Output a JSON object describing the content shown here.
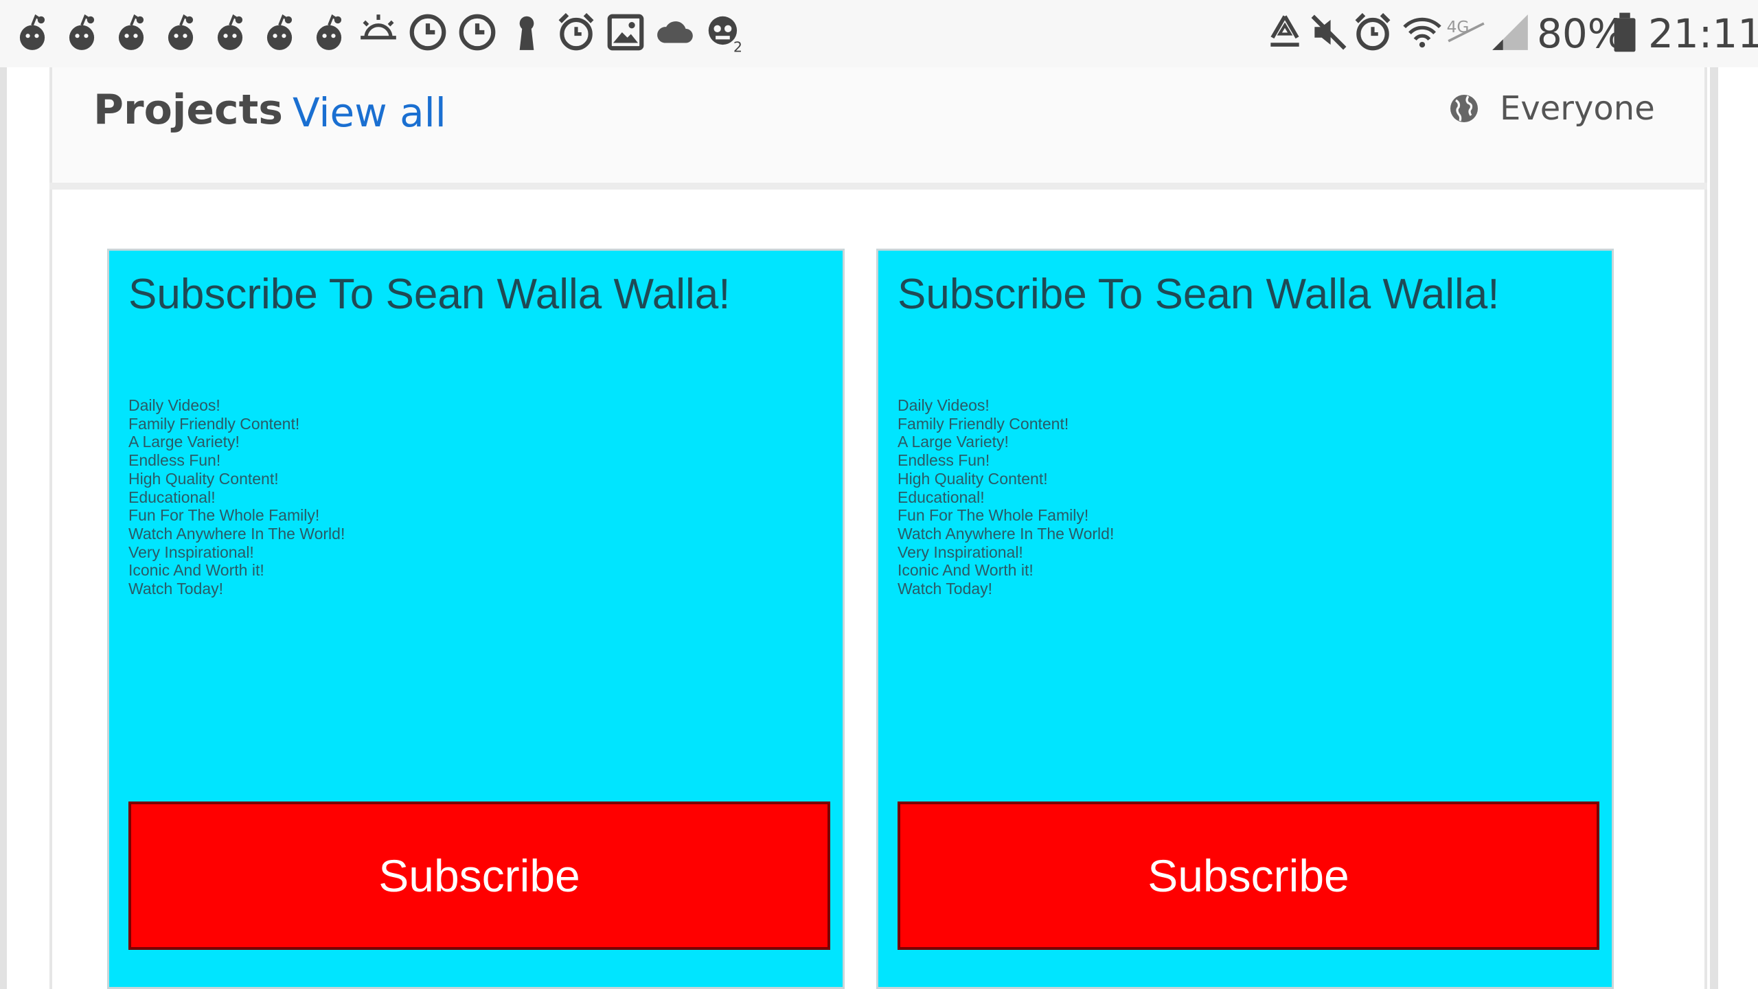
{
  "status_bar": {
    "left_icons": [
      "reddit-icon",
      "reddit-icon",
      "reddit-icon",
      "reddit-icon",
      "reddit-icon",
      "reddit-icon",
      "reddit-icon",
      "sunrise-icon",
      "clock-icon",
      "clock-icon",
      "keyhole-icon",
      "alarm-icon",
      "image-icon",
      "cloud-icon",
      "game-icon"
    ],
    "right_icons": [
      "recycle-icon",
      "mute-icon",
      "alarm-icon",
      "wifi-icon",
      "network-4g-icon",
      "signal-icon",
      "battery-icon"
    ],
    "network_label": "4G",
    "battery_percent": "80%",
    "time": "21:11"
  },
  "header": {
    "title": "Projects",
    "view_all": "View all",
    "visibility": "Everyone",
    "visibility_icon": "globe-icon"
  },
  "projects": [
    {
      "title": "Subscribe To Sean Walla Walla!",
      "features": [
        "Daily Videos!",
        "Family Friendly Content!",
        "A Large Variety!",
        "Endless Fun!",
        "High Quality Content!",
        "Educational!",
        "Fun For The Whole Family!",
        "Watch Anywhere In The World!",
        "Very Inspirational!",
        "Iconic And Worth it!",
        "Watch Today!"
      ],
      "button_label": "Subscribe"
    },
    {
      "title": "Subscribe To Sean Walla Walla!",
      "features": [
        "Daily Videos!",
        "Family Friendly Content!",
        "A Large Variety!",
        "Endless Fun!",
        "High Quality Content!",
        "Educational!",
        "Fun For The Whole Family!",
        "Watch Anywhere In The World!",
        "Very Inspirational!",
        "Iconic And Worth it!",
        "Watch Today!"
      ],
      "button_label": "Subscribe"
    }
  ],
  "colors": {
    "card_background": "#00e5ff",
    "subscribe_button": "#ff0000",
    "link": "#1a6fd1"
  }
}
